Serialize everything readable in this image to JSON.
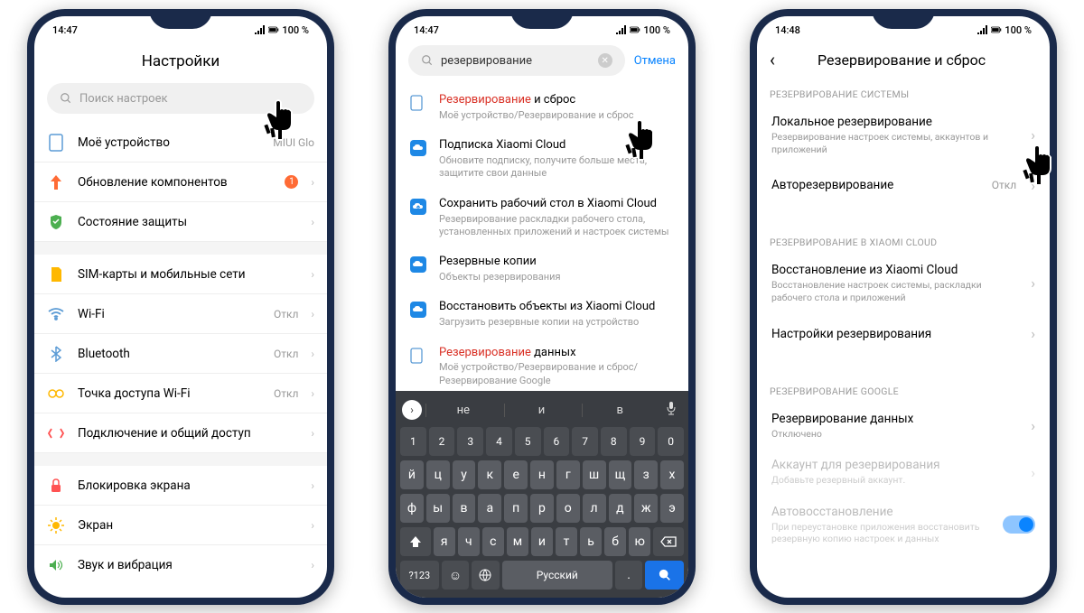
{
  "phone1": {
    "status": {
      "time": "14:47",
      "battery": "100 %"
    },
    "title": "Настройки",
    "search_placeholder": "Поиск настроек",
    "rows": {
      "my_device": {
        "label": "Моё устройство",
        "value": "MIUI Glo"
      },
      "update": {
        "label": "Обновление компонентов",
        "badge": "1"
      },
      "security": {
        "label": "Состояние защиты"
      },
      "sim": {
        "label": "SIM-карты и мобильные сети"
      },
      "wifi": {
        "label": "Wi-Fi",
        "value": "Откл"
      },
      "bluetooth": {
        "label": "Bluetooth",
        "value": "Откл"
      },
      "hotspot": {
        "label": "Точка доступа Wi-Fi",
        "value": "Откл"
      },
      "sharing": {
        "label": "Подключение и общий доступ"
      },
      "lock": {
        "label": "Блокировка экрана"
      },
      "display": {
        "label": "Экран"
      },
      "sound": {
        "label": "Звук и вибрация"
      }
    }
  },
  "phone2": {
    "status": {
      "time": "14:47",
      "battery": "100 %"
    },
    "search_query": "резервирование",
    "cancel": "Отмена",
    "results": {
      "r1": {
        "hl": "Резервирование",
        "rest": " и сброс",
        "sub": "Моё устройство/Резервирование и сброс"
      },
      "r2": {
        "title": "Подписка Xiaomi Cloud",
        "sub": "Обновите подписку, получите больше места, защитите свои данные"
      },
      "r3": {
        "title": "Сохранить рабочий стол в Xiaomi Cloud",
        "sub": "Резервирование раскладки рабочего стола, установленных приложений и настроек системы"
      },
      "r4": {
        "title": "Резервные копии",
        "sub": "Объекты резервирования"
      },
      "r5": {
        "title": "Восстановить объекты из Xiaomi Cloud",
        "sub": "Загрузить резервные копии на устройство"
      },
      "r6": {
        "hl": "Резервирование",
        "rest": " данных",
        "sub": "Моё устройство/Резервирование и сброс/Резервирование Google"
      }
    },
    "keyboard": {
      "suggestions": [
        "не",
        "и",
        "в"
      ],
      "num_row": [
        "1",
        "2",
        "3",
        "4",
        "5",
        "6",
        "7",
        "8",
        "9",
        "0"
      ],
      "row1": [
        "й",
        "ц",
        "у",
        "к",
        "е",
        "н",
        "г",
        "ш",
        "щ",
        "з",
        "х"
      ],
      "row2": [
        "ф",
        "ы",
        "в",
        "а",
        "п",
        "р",
        "о",
        "л",
        "д",
        "ж",
        "э"
      ],
      "row3": [
        "я",
        "ч",
        "с",
        "м",
        "и",
        "т",
        "ь",
        "б",
        "ю"
      ],
      "bottom": {
        "sym": "?123",
        "lang": "Русский"
      }
    }
  },
  "phone3": {
    "status": {
      "time": "14:48",
      "battery": "100 %"
    },
    "title": "Резервирование и сброс",
    "sections": {
      "system": {
        "header": "РЕЗЕРВИРОВАНИЕ СИСТЕМЫ",
        "local": {
          "title": "Локальное резервирование",
          "sub": "Резервирование настроек системы, аккаунтов и приложений"
        },
        "auto": {
          "title": "Авторезервирование",
          "value": "Откл"
        }
      },
      "cloud": {
        "header": "РЕЗЕРВИРОВАНИЕ В XIAOMI CLOUD",
        "restore": {
          "title": "Восстановление из Xiaomi Cloud",
          "sub": "Восстановление настроек системы, раскладки рабочего стола и приложений"
        },
        "settings": {
          "title": "Настройки резервирования"
        }
      },
      "google": {
        "header": "РЕЗЕРВИРОВАНИЕ GOOGLE",
        "backup": {
          "title": "Резервирование данных",
          "sub": "Отключено"
        },
        "account": {
          "title": "Аккаунт для резервирования",
          "sub": "Добавьте резервный аккаунт."
        },
        "autorestore": {
          "title": "Автовосстановление",
          "sub": "При переустановке приложения восстановить резервную копию настроек и данных"
        }
      }
    }
  }
}
